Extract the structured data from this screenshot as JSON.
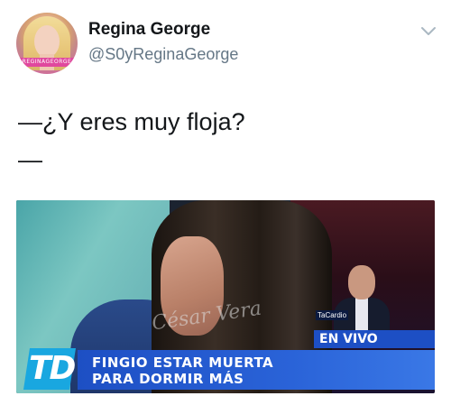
{
  "user": {
    "display_name": "Regina George",
    "handle": "@S0yReginaGeorge",
    "avatar_badge": "REGINAGEORGE"
  },
  "tweet": {
    "line1": "—¿Y eres muy floja?",
    "line2": "—"
  },
  "media": {
    "live_label": "EN VIVO",
    "headline_line1": "FINGIO ESTAR MUERTA",
    "headline_line2": "PARA DORMIR MÁS",
    "watermark": "César Vera",
    "channel_logo": "TD",
    "small_tag": "TaCardio"
  },
  "icons": {
    "caret": "chevron-down-icon"
  },
  "colors": {
    "text_primary": "#14171a",
    "text_secondary": "#657786",
    "lower_third_blue": "#1d4fc4",
    "logo_cyan": "#19a7e0"
  }
}
